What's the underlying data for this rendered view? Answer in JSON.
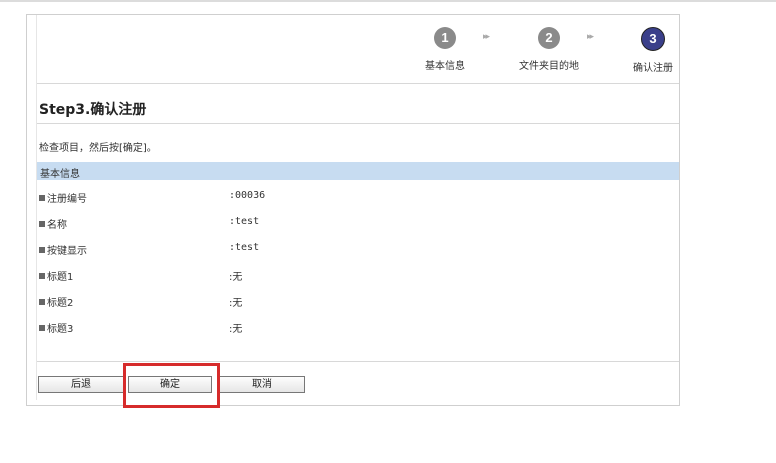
{
  "steps": [
    {
      "number": "1",
      "label": "基本信息"
    },
    {
      "number": "2",
      "label": "文件夹目的地"
    },
    {
      "number": "3",
      "label": "确认注册"
    }
  ],
  "step_arrow": "▸▸",
  "page_title": "Step3.确认注册",
  "hint": "检查项目，然后按[确定]。",
  "section_title": "基本信息",
  "rows": [
    {
      "label": "注册编号",
      "value": ":00036"
    },
    {
      "label": "名称",
      "value": ":test"
    },
    {
      "label": "按键显示",
      "value": ":test"
    },
    {
      "label": "标题1",
      "value": ":无"
    },
    {
      "label": "标题2",
      "value": ":无"
    },
    {
      "label": "标题3",
      "value": ":无"
    }
  ],
  "buttons": {
    "back": "后退",
    "ok": "确定",
    "cancel": "取消"
  },
  "colors": {
    "section_bg": "#c7dcf1",
    "active_step": "#3a3f8a",
    "done_step": "#8a8a8a",
    "highlight": "#d62b2b"
  }
}
